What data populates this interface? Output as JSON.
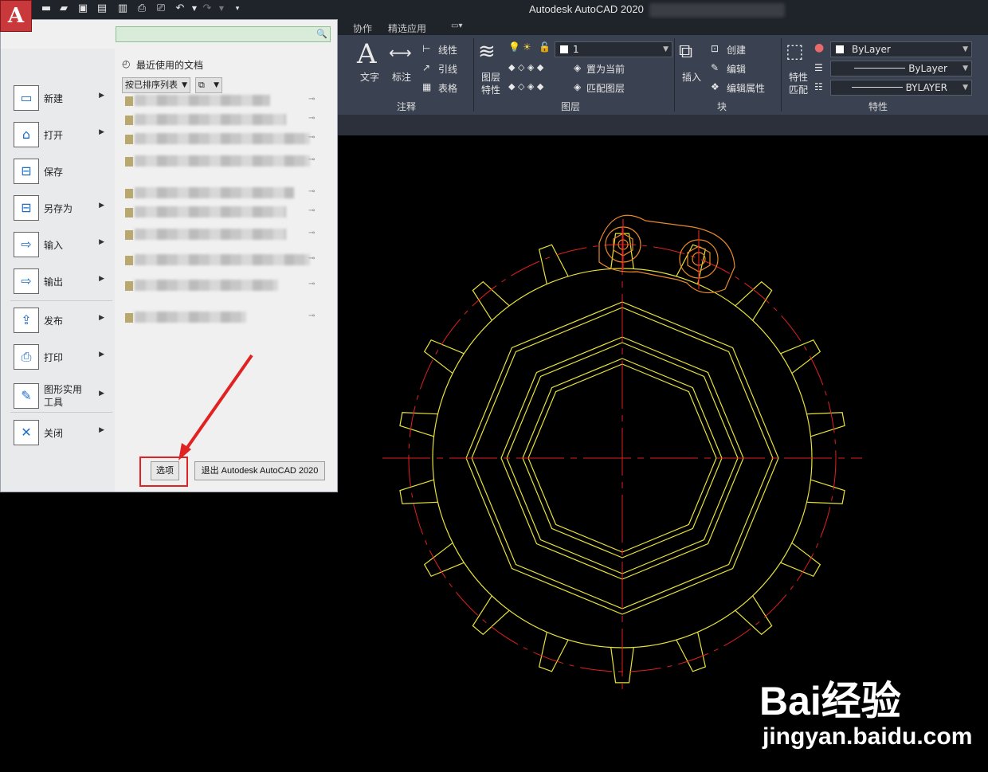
{
  "window": {
    "title": "Autodesk AutoCAD 2020",
    "app_letter": "A"
  },
  "tabs": [
    "协作",
    "精选应用"
  ],
  "ribbon": {
    "annotation": {
      "title": "注释",
      "text_label": "文字",
      "dimension_label": "标注",
      "linear": "线性",
      "leader": "引线",
      "table": "表格"
    },
    "layers": {
      "title": "图层",
      "layer_props": [
        "图层",
        "特性"
      ],
      "layer_value": "1",
      "set_current": "置为当前",
      "match_layer": "匹配图层"
    },
    "block": {
      "title": "块",
      "insert": "插入",
      "create": "创建",
      "edit": "编辑",
      "edit_attr": "编辑属性"
    },
    "properties": {
      "title": "特性",
      "match": [
        "特性",
        "匹配"
      ],
      "color": "ByLayer",
      "linetype": "ByLayer",
      "lineweight": "BYLAYER"
    }
  },
  "app_menu": {
    "items": [
      {
        "label": "新建",
        "arrow": true
      },
      {
        "label": "打开",
        "arrow": true
      },
      {
        "label": "保存",
        "arrow": false
      },
      {
        "label": "另存为",
        "arrow": true
      },
      {
        "label": "输入",
        "arrow": true
      },
      {
        "label": "输出",
        "arrow": true
      },
      {
        "label": "发布",
        "arrow": true
      },
      {
        "label": "打印",
        "arrow": true
      },
      {
        "label": "图形实用\n工具",
        "arrow": true
      },
      {
        "label": "关闭",
        "arrow": true
      }
    ],
    "recent_title": "最近使用的文档",
    "sort_label": "按已排序列表",
    "options_label": "选项",
    "exit_label": "退出 Autodesk AutoCAD 2020"
  },
  "watermark": {
    "brand": "Bai经验",
    "url": "jingyan.baidu.com"
  }
}
